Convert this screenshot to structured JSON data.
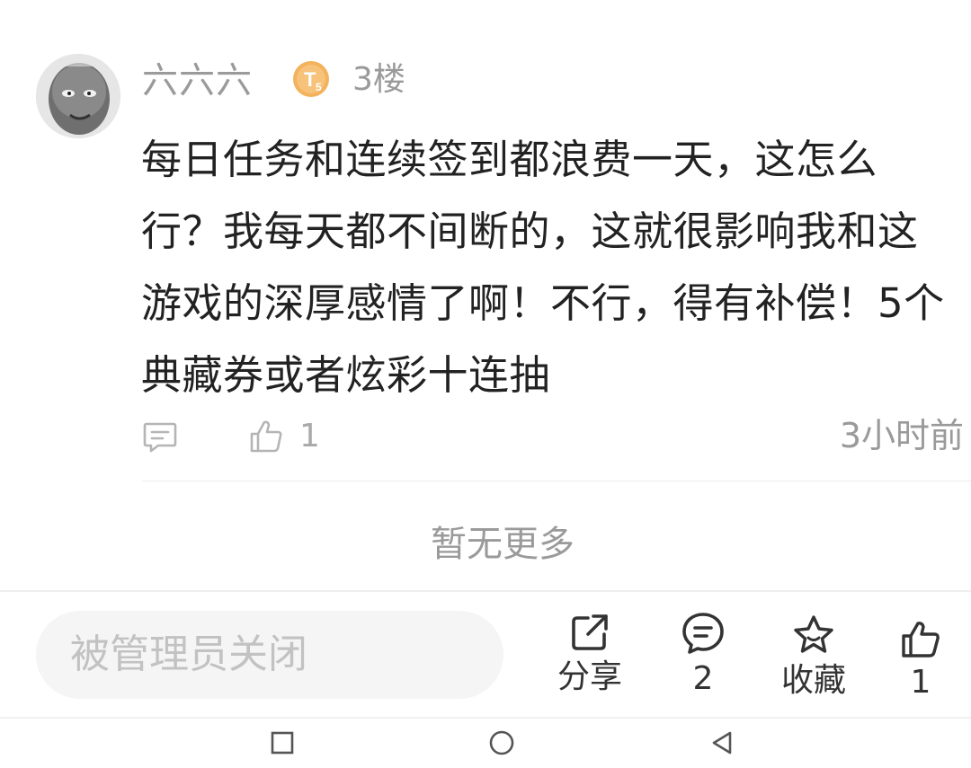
{
  "comment": {
    "username": "六六六",
    "badge_text": "T",
    "badge_sub": "5",
    "floor": "3楼",
    "content": "每日任务和连续签到都浪费一天，这怎么行？我每天都不间断的，这就很影响我和这游戏的深厚感情了啊！不行，得有补偿！5个典藏券或者炫彩十连抽",
    "like_count": "1",
    "time": "3小时前",
    "icons": {
      "reply": "comment-reply-icon",
      "like": "thumb-up-icon"
    }
  },
  "list_end_text": "暂无更多",
  "bottom_bar": {
    "input_placeholder": "被管理员关闭",
    "share_label": "分享",
    "comment_count": "2",
    "favorite_label": "收藏",
    "like_count": "1"
  },
  "nav": {
    "buttons": [
      "recent-apps",
      "home",
      "back"
    ]
  },
  "colors": {
    "text": "#222222",
    "muted": "#9a9a9a",
    "badge": "#f0a64a"
  }
}
